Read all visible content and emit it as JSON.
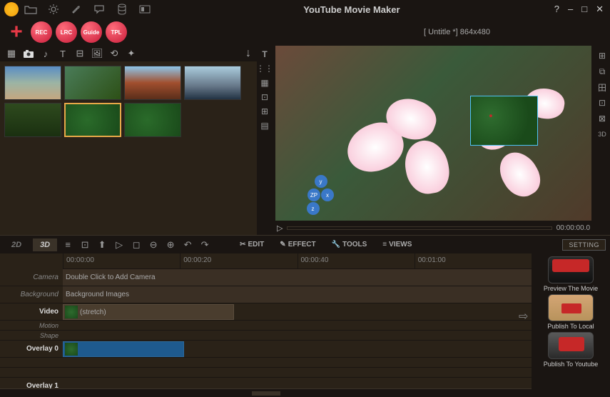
{
  "app": {
    "title": "YouTube Movie Maker"
  },
  "window": {
    "help": "?",
    "min": "–",
    "max": "□",
    "close": "✕"
  },
  "toolbar": {
    "plus": "+",
    "rec": "REC",
    "lrc": "LRC",
    "guide": "Guide",
    "tpl": "TPL"
  },
  "doc": {
    "title": "[ Untitle *]  864x480"
  },
  "media_tabs": {
    "video": "▦",
    "camera": "📷",
    "music": "♪",
    "text": "T",
    "sub": "⊟",
    "image": "🖼",
    "fx": "⟲",
    "puzzle": "✦"
  },
  "side_left": {
    "text": "T",
    "dots": "⋮⋮",
    "a": "▦",
    "b": "⊡",
    "c": "⊞",
    "d": "▤"
  },
  "side_right": {
    "a": "⊞",
    "b": "⧉",
    "c": "田",
    "d": "⊡",
    "e": "⊠",
    "threeD": "3D"
  },
  "playback": {
    "play": "▷",
    "time": "00:00:00.0"
  },
  "handle3d": {
    "y": "y",
    "zp": "ZP",
    "x": "x",
    "z": "z"
  },
  "dim": {
    "twoD": "2D",
    "threeD": "3D"
  },
  "tlbtn": {
    "menu": "≡",
    "cam": "⊡",
    "up": "⬆",
    "play": "▷",
    "stop": "◻",
    "zoomout": "⊖",
    "zoomin": "⊕",
    "undo": "↶",
    "redo": "↷"
  },
  "editor_tabs": {
    "edit": "EDIT",
    "effect": "EFFECT",
    "tools": "TOOLS",
    "views": "VIEWS",
    "setting": "SETTING"
  },
  "editor_icons": {
    "edit": "✂",
    "effect": "✎",
    "tools": "🔧",
    "views": "≡"
  },
  "ruler": [
    "00:00:00",
    "00:00:20",
    "00:00:40",
    "00:01:00"
  ],
  "tracks": {
    "camera": {
      "label": "Camera",
      "hint": "Double Click to Add Camera"
    },
    "background": {
      "label": "Background",
      "hint": "Background Images"
    },
    "video": {
      "label": "Video",
      "clip": "(stretch)"
    },
    "motion": {
      "label": "Motion"
    },
    "shape": {
      "label": "Shape"
    },
    "overlay0": {
      "label": "Overlay 0"
    },
    "overlay1": {
      "label": "Overlay 1"
    }
  },
  "arrow_right": "⇨",
  "actions": {
    "preview": "Preview The Movie",
    "local": "Publish To Local",
    "youtube": "Publish To Youtube"
  }
}
